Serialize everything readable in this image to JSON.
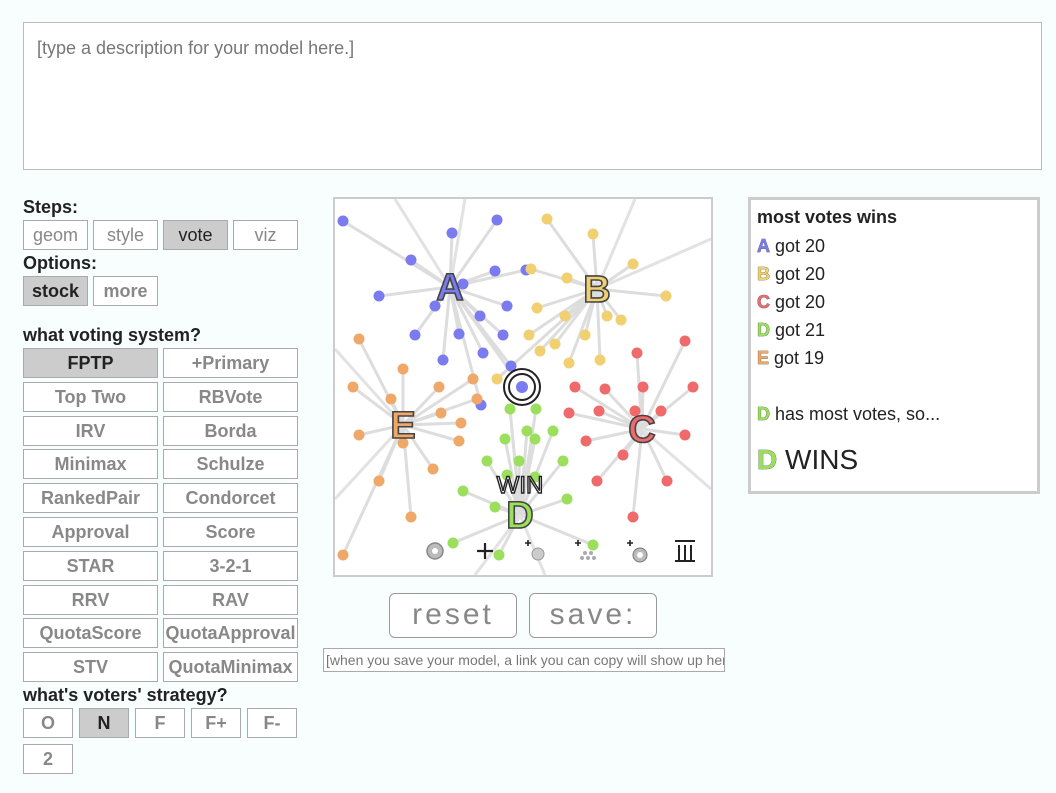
{
  "description_placeholder": "[type a description for your model here.]",
  "steps": {
    "label": "Steps:",
    "items": [
      "geom",
      "style",
      "vote",
      "viz"
    ],
    "selected": "vote"
  },
  "options": {
    "label": "Options:",
    "items": [
      "stock",
      "more"
    ],
    "selected": "stock"
  },
  "voting_system": {
    "label": "what voting system?",
    "items": [
      "FPTP",
      "+Primary",
      "Top Two",
      "RBVote",
      "IRV",
      "Borda",
      "Minimax",
      "Schulze",
      "RankedPair",
      "Condorcet",
      "Approval",
      "Score",
      "STAR",
      "3-2-1",
      "RRV",
      "RAV",
      "QuotaScore",
      "QuotaApproval",
      "STV",
      "QuotaMinimax"
    ],
    "selected": "FPTP"
  },
  "strategy": {
    "label": "what's voters' strategy?",
    "items": [
      "O",
      "N",
      "F",
      "F+",
      "F-",
      "2"
    ],
    "selected": "N"
  },
  "sim": {
    "candidates": [
      {
        "letter": "A",
        "color": "#7b7bf0"
      },
      {
        "letter": "B",
        "color": "#f0d070"
      },
      {
        "letter": "C",
        "color": "#ef6a6a"
      },
      {
        "letter": "D",
        "color": "#9bdf5c"
      },
      {
        "letter": "E",
        "color": "#f0a868"
      }
    ],
    "win_label": "WIN",
    "toolbar_icons": [
      "gear-icon",
      "plus-icon",
      "add-voter-icon",
      "add-crowd-icon",
      "add-gear-crowd-icon",
      "trash-icon"
    ]
  },
  "reset_label": "reset",
  "save_label": "save:",
  "save_link_placeholder": "[when you save your model, a link you can copy will show up here.]",
  "results": {
    "title": "most votes wins",
    "tallies": [
      {
        "letter": "A",
        "text": " got 20",
        "color": "#7b7bf0"
      },
      {
        "letter": "B",
        "text": " got 20",
        "color": "#f0d070"
      },
      {
        "letter": "C",
        "text": " got 20",
        "color": "#ef6a6a"
      },
      {
        "letter": "D",
        "text": " got 21",
        "color": "#9bdf5c"
      },
      {
        "letter": "E",
        "text": " got 19",
        "color": "#f0a868"
      }
    ],
    "most_votes": {
      "letter": "D",
      "text": " has most votes, so...",
      "color": "#9bdf5c"
    },
    "winner": {
      "letter": "D",
      "text": " WINS",
      "color": "#9bdf5c"
    }
  }
}
